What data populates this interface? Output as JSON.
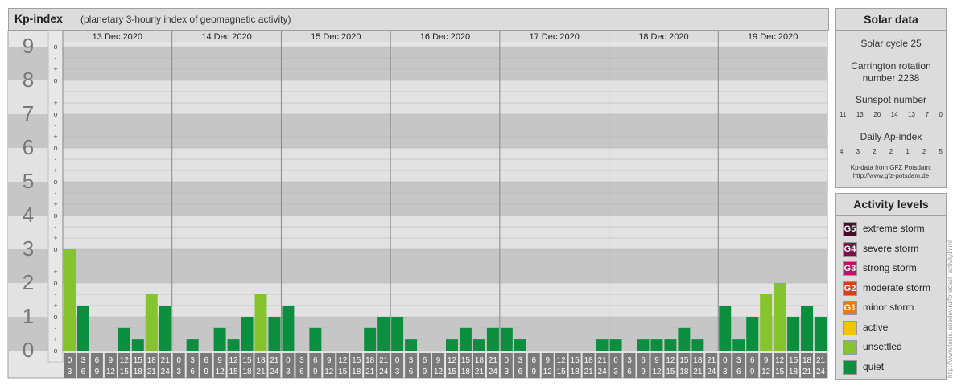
{
  "title": "Kp-index",
  "subtitle": "(planetary 3-hourly index of geomagnetic activity)",
  "chart_data": {
    "type": "bar",
    "days": [
      "13 Dec 2020",
      "14 Dec 2020",
      "15 Dec 2020",
      "16 Dec 2020",
      "17 Dec 2020",
      "18 Dec 2020",
      "19 Dec 2020"
    ],
    "interval_starts": [
      "0",
      "3",
      "6",
      "9",
      "12",
      "15",
      "18",
      "21"
    ],
    "interval_ends": [
      "3",
      "6",
      "9",
      "12",
      "15",
      "18",
      "21",
      "24"
    ],
    "y_ticks": [
      "0",
      "1",
      "2",
      "3",
      "4",
      "5",
      "6",
      "7",
      "8",
      "9"
    ],
    "thirds_labels": [
      "o",
      "+",
      "-"
    ],
    "ylim": [
      0,
      9
    ],
    "values": [
      [
        3.0,
        1.33,
        0,
        0,
        0.67,
        0.33,
        1.67,
        1.33
      ],
      [
        0,
        0.33,
        0,
        0.67,
        0.33,
        1.0,
        1.67,
        1.0
      ],
      [
        1.33,
        0,
        0.67,
        0,
        0,
        0,
        0.67,
        1.0
      ],
      [
        1.0,
        0.33,
        0,
        0,
        0.33,
        0.67,
        0.33,
        0.67
      ],
      [
        0.67,
        0.33,
        0,
        0,
        0,
        0,
        0,
        0.33
      ],
      [
        0.33,
        0,
        0.33,
        0.33,
        0.33,
        0.67,
        0.33,
        0
      ],
      [
        1.33,
        0.33,
        1.0,
        1.67,
        2.0,
        1.0,
        1.33,
        1.0
      ]
    ],
    "colors": {
      "quiet": "#0b8f3f",
      "unsettled": "#86c42e",
      "band_dark": "#c6c6c6",
      "band_light": "#e2e2e2",
      "xlabel_bg": "#7a7a7a"
    },
    "unsettled_threshold": 1.67
  },
  "solar": {
    "title": "Solar data",
    "cycle": "Solar cycle 25",
    "carrington_1": "Carrington rotation",
    "carrington_2": "number 2238",
    "sunspot_label": "Sunspot number",
    "sunspot_values": [
      "11",
      "13",
      "20",
      "14",
      "13",
      "7",
      "0"
    ],
    "ap_label": "Daily Ap-index",
    "ap_values": [
      "4",
      "3",
      "2",
      "2",
      "1",
      "2",
      "5"
    ],
    "credit_1": "Kp-data from GFZ Potsdam:",
    "credit_2": "http://www.gfz-potsdam.de"
  },
  "levels": {
    "title": "Activity levels",
    "items": [
      {
        "code": "G5",
        "label": "extreme storm",
        "color": "#4a0a2a"
      },
      {
        "code": "G4",
        "label": "severe storm",
        "color": "#7a0e4a"
      },
      {
        "code": "G3",
        "label": "strong storm",
        "color": "#b4186a"
      },
      {
        "code": "G2",
        "label": "moderate storm",
        "color": "#d8401c"
      },
      {
        "code": "G1",
        "label": "minor storm",
        "color": "#e87c14"
      },
      {
        "code": "",
        "label": "active",
        "color": "#f5c400"
      },
      {
        "code": "",
        "label": "unsettled",
        "color": "#86c42e"
      },
      {
        "code": "",
        "label": "quiet",
        "color": "#0b8f3f"
      }
    ]
  },
  "watermark": "http://www.tesis.lebedev.ru/forecast_activity.html"
}
